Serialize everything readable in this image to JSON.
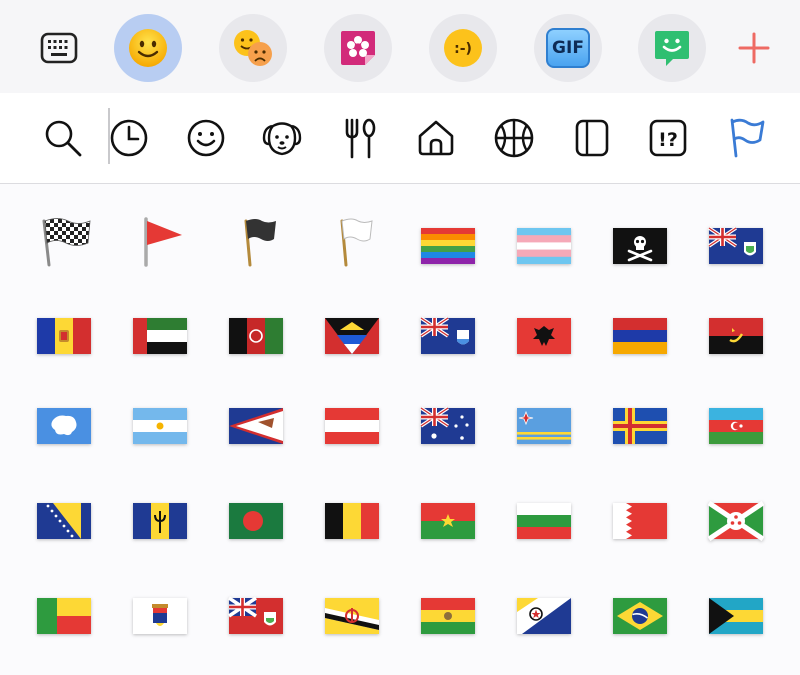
{
  "toolbar": {
    "tabs": [
      {
        "name": "keyboard-icon"
      },
      {
        "name": "smiley-emoji-icon",
        "active": true
      },
      {
        "name": "combined-emoji-icon"
      },
      {
        "name": "sticker-icon"
      },
      {
        "name": "text-emoticon-icon"
      },
      {
        "name": "gif-icon",
        "label": "GIF"
      },
      {
        "name": "bitmoji-icon"
      },
      {
        "name": "add-icon"
      }
    ],
    "text_emoticon": ":-)"
  },
  "categories": [
    {
      "name": "search-icon"
    },
    {
      "name": "recent-clock-icon"
    },
    {
      "name": "smileys-icon"
    },
    {
      "name": "animals-icon"
    },
    {
      "name": "food-icon"
    },
    {
      "name": "travel-places-icon"
    },
    {
      "name": "activities-icon"
    },
    {
      "name": "objects-icon"
    },
    {
      "name": "symbols-icon",
      "label": "!?"
    },
    {
      "name": "flags-icon",
      "active": true
    }
  ],
  "colors": {
    "accent": "#3a7bd5",
    "active_tab_bg": "#b8cdf2",
    "add_icon": "#ee6a63"
  },
  "flags": [
    "chequered-flag",
    "triangular-flag",
    "black-flag",
    "white-flag",
    "rainbow-flag",
    "transgender-flag",
    "pirate-flag",
    "ascension-island-flag",
    "andorra-flag",
    "uae-flag",
    "afghanistan-flag",
    "antigua-barbuda-flag",
    "anguilla-flag",
    "albania-flag",
    "armenia-flag",
    "angola-flag",
    "antarctica-flag",
    "argentina-flag",
    "american-samoa-flag",
    "austria-flag",
    "australia-flag",
    "aruba-flag",
    "aland-islands-flag",
    "azerbaijan-flag",
    "bosnia-herzegovina-flag",
    "barbados-flag",
    "bangladesh-flag",
    "belgium-flag",
    "burkina-faso-flag",
    "bulgaria-flag",
    "bahrain-flag",
    "burundi-flag",
    "benin-flag",
    "st-barthelemy-flag",
    "bermuda-flag",
    "brunei-flag",
    "bolivia-flag",
    "caribbean-netherlands-flag",
    "brazil-flag",
    "bahamas-flag"
  ]
}
